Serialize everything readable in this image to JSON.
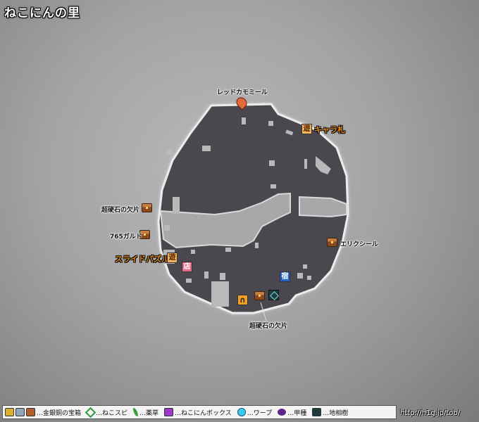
{
  "title": "ねこにんの里",
  "labels": {
    "top_item": "レッドカモミール",
    "chara_fuda": "キャラ札",
    "chest_left_1": "超硬石の欠片",
    "chest_left_2": "765ガルド",
    "slide_puzzle": "スライドパズル",
    "eric_seal": "エリクシール",
    "chest_bottom": "超硬石の欠片"
  },
  "badges": {
    "play": "遊",
    "shop": "店",
    "inn": "宿"
  },
  "legend": {
    "chest": "…金銀銅の宝箱",
    "nekospi": "…ねこスピ",
    "herb": "…薬草",
    "nekonin_box": "…ねこにんボックス",
    "warp": "…ワープ",
    "beetle": "…甲種",
    "earth_tree": "…地相樹"
  },
  "url": "http://h1g.jp/tob/",
  "colors": {
    "floor": "#4a474f",
    "floor_border": "#e9e9e9",
    "accent_orange": "#e08a1a",
    "chest_brown": "#8a4a1e",
    "shop_pink": "#e76a8a",
    "inn_blue": "#2a63c8"
  }
}
